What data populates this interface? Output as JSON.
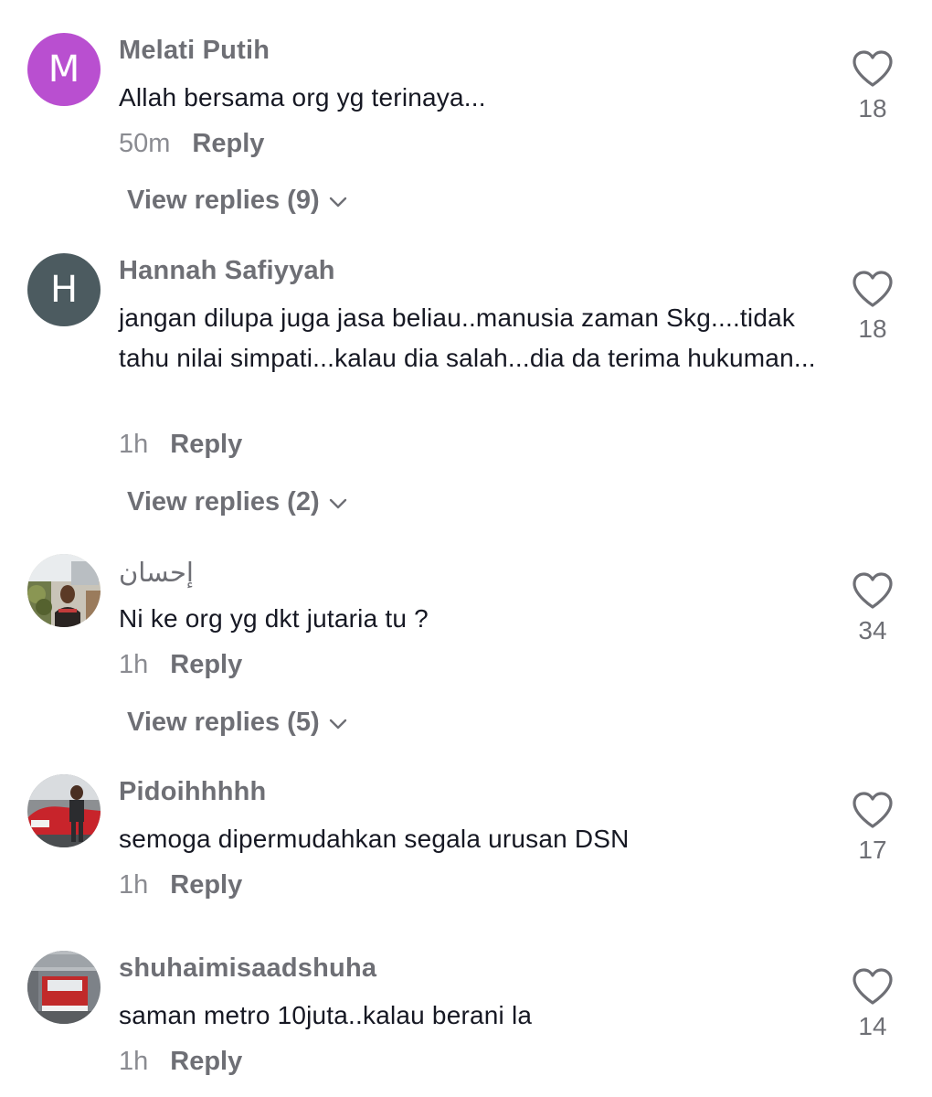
{
  "comments": [
    {
      "username": "Melati Putih",
      "text": "Allah bersama org yg terinaya...",
      "time": "50m",
      "reply_label": "Reply",
      "likes": "18",
      "view_replies": "View replies (9)",
      "avatar": {
        "type": "initial",
        "initial": "M",
        "color": "#b94fd0"
      }
    },
    {
      "username": "Hannah Safiyyah",
      "text": "jangan dilupa juga jasa beliau..manusia zaman Skg....tidak tahu nilai simpati...kalau dia salah...dia da terima hukuman...",
      "time": "1h",
      "reply_label": "Reply",
      "likes": "18",
      "view_replies": "View replies (2)",
      "avatar": {
        "type": "initial",
        "initial": "H",
        "color": "#4c5b60"
      }
    },
    {
      "username": "إحسان",
      "text": "Ni ke org yg dkt jutaria tu ?",
      "time": "1h",
      "reply_label": "Reply",
      "likes": "34",
      "view_replies": "View replies (5)",
      "avatar": {
        "type": "photo"
      }
    },
    {
      "username": "Pidoihhhhh",
      "text": "semoga dipermudahkan segala urusan DSN",
      "time": "1h",
      "reply_label": "Reply",
      "likes": "17",
      "avatar": {
        "type": "photo"
      }
    },
    {
      "username": "shuhaimisaadshuha",
      "text": "saman metro 10juta..kalau berani la",
      "time": "1h",
      "reply_label": "Reply",
      "likes": "14",
      "avatar": {
        "type": "photo"
      }
    }
  ],
  "icons": {
    "like": "heart-outline-icon",
    "expand": "chevron-down-icon"
  }
}
